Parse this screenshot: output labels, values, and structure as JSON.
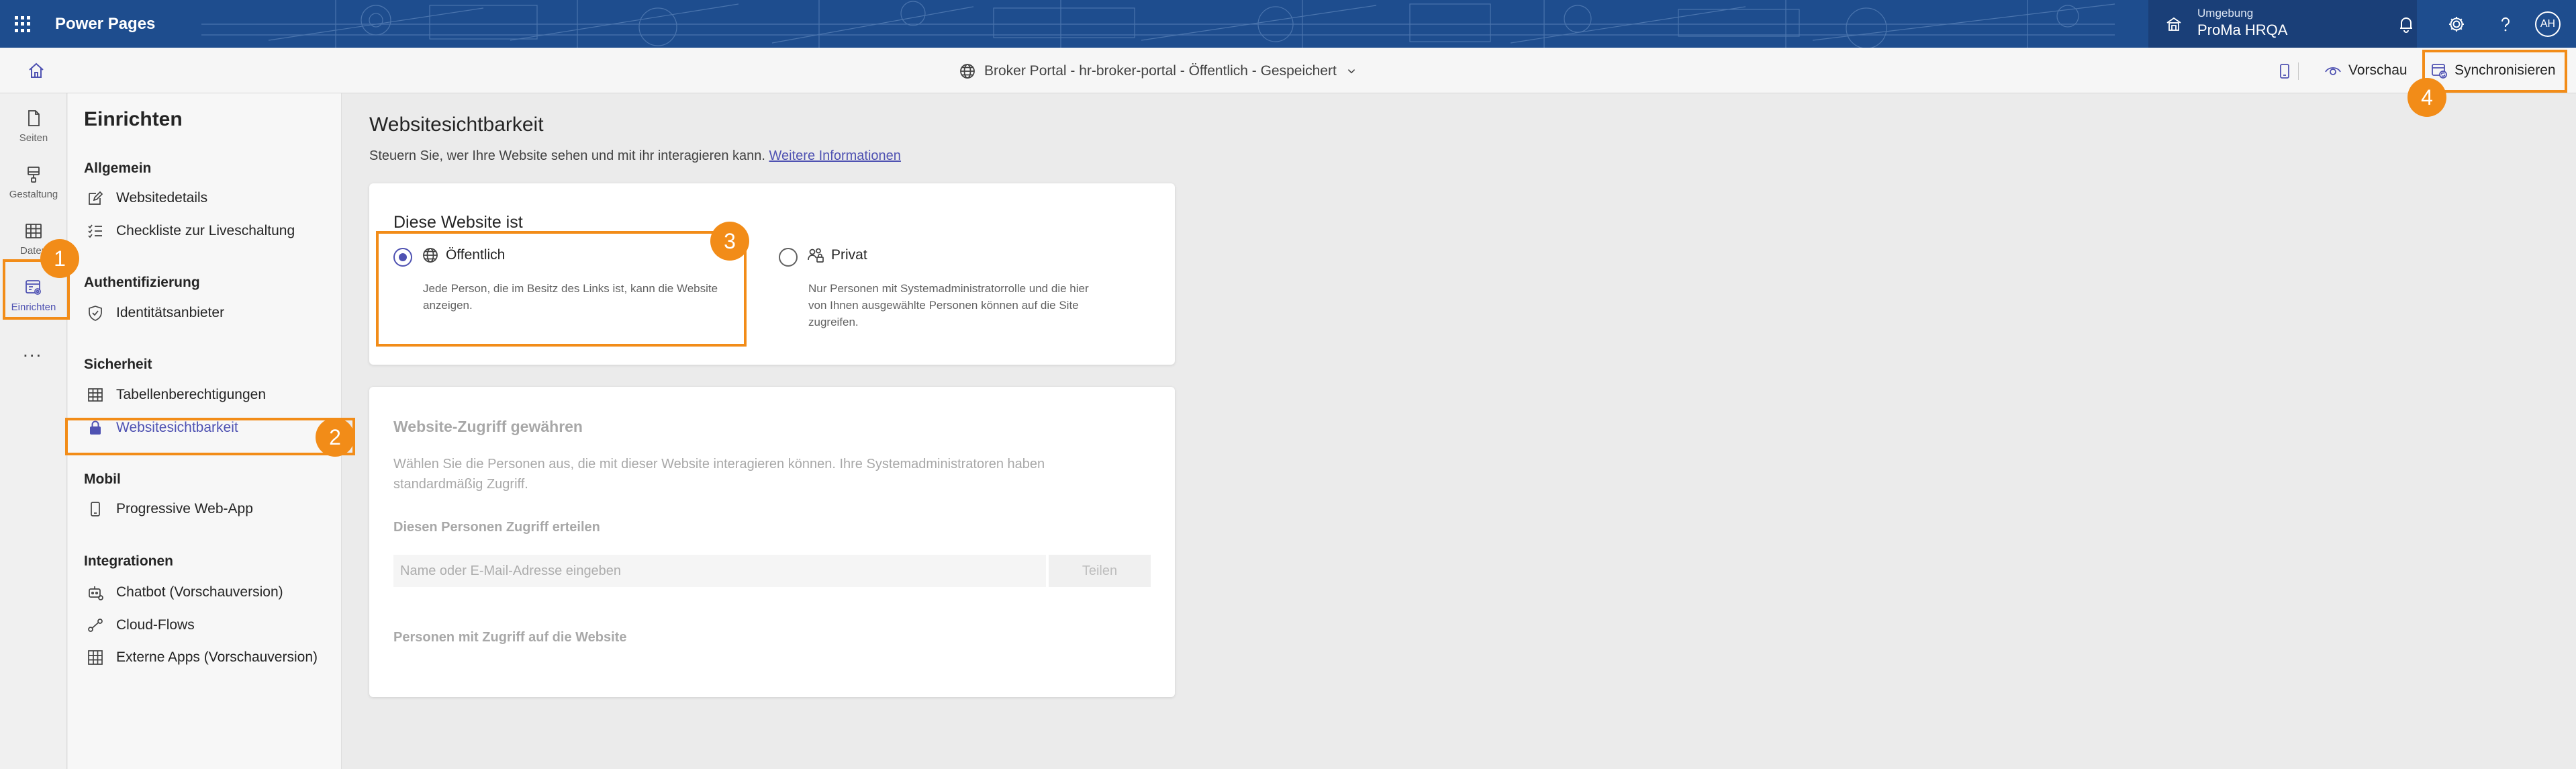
{
  "app": {
    "name": "Power Pages"
  },
  "header": {
    "environment_label": "Umgebung",
    "environment_value": "ProMa HRQA",
    "avatar_initials": "AH"
  },
  "command_bar": {
    "site_title": "Broker Portal - hr-broker-portal - Öffentlich - Gespeichert",
    "preview_label": "Vorschau",
    "sync_label": "Synchronisieren"
  },
  "rail": {
    "items": [
      {
        "label": "Seiten",
        "icon": "page-icon"
      },
      {
        "label": "Gestaltung",
        "icon": "paint-brush-icon"
      },
      {
        "label": "Daten",
        "icon": "table-icon"
      },
      {
        "label": "Einrichten",
        "icon": "setup-icon"
      }
    ],
    "more": "..."
  },
  "nav": {
    "title": "Einrichten",
    "sections": [
      {
        "title": "Allgemein",
        "items": [
          {
            "label": "Websitedetails",
            "icon": "edit-icon"
          },
          {
            "label": "Checkliste zur Liveschaltung",
            "icon": "checklist-icon"
          }
        ]
      },
      {
        "title": "Authentifizierung",
        "items": [
          {
            "label": "Identitätsanbieter",
            "icon": "shield-icon"
          }
        ]
      },
      {
        "title": "Sicherheit",
        "items": [
          {
            "label": "Tabellenberechtigungen",
            "icon": "table-icon"
          },
          {
            "label": "Websitesichtbarkeit",
            "icon": "lock-icon"
          }
        ]
      },
      {
        "title": "Mobil",
        "items": [
          {
            "label": "Progressive Web-App",
            "icon": "phone-icon"
          }
        ]
      },
      {
        "title": "Integrationen",
        "items": [
          {
            "label": "Chatbot (Vorschauversion)",
            "icon": "bot-icon"
          },
          {
            "label": "Cloud-Flows",
            "icon": "flow-icon"
          },
          {
            "label": "Externe Apps (Vorschauversion)",
            "icon": "grid-icon"
          }
        ]
      }
    ]
  },
  "main": {
    "title": "Websitesichtbarkeit",
    "description": "Steuern Sie, wer Ihre Website sehen und mit ihr interagieren kann.",
    "more_info_link": "Weitere Informationen",
    "visibility": {
      "title": "Diese Website ist",
      "public_label": "Öffentlich",
      "public_desc_1": "Jede Person, die im Besitz des Links ist, kann die Website",
      "public_desc_2": "anzeigen.",
      "private_label": "Privat",
      "private_desc_1": "Nur Personen mit Systemadministratorrolle und die hier",
      "private_desc_2": "von Ihnen ausgewählte Personen können auf die Site",
      "private_desc_3": "zugreifen.",
      "selected": "Öffentlich"
    },
    "access": {
      "title": "Website-Zugriff gewähren",
      "desc_1": "Wählen Sie die Personen aus, die mit dieser Website interagieren können. Ihre Systemadministratoren haben",
      "desc_2": "standardmäßig Zugriff.",
      "grant_title": "Diesen Personen Zugriff erteilen",
      "input_placeholder": "Name oder E-Mail-Adresse eingeben",
      "share_button": "Teilen",
      "people_title": "Personen mit Zugriff auf die Website"
    }
  },
  "annotations": {
    "badge_1": "1",
    "badge_2": "2",
    "badge_3": "3",
    "badge_4": "4"
  },
  "colors": {
    "header_bg": "#1e4d8e",
    "accent": "#4f52b2",
    "annotation": "#f28c18"
  }
}
